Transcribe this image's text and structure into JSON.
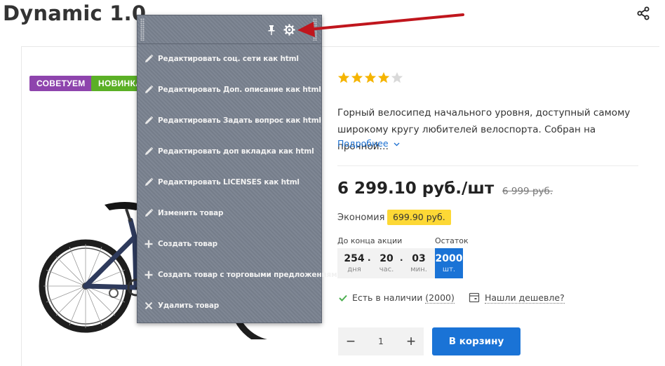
{
  "page": {
    "title": "Dynamic 1.0"
  },
  "badges": {
    "advise": "СОВЕТУЕМ",
    "new": "НОВИНКА"
  },
  "rating": {
    "stars_filled": 4,
    "stars_total": 5
  },
  "product": {
    "description_line1": "Горный велосипед начального уровня, доступный самому",
    "description_line2": "широкому кругу любителей велоспорта. Собран на прочной…",
    "more_link": "Подробнее",
    "price": "6 299.10 руб./шт",
    "old_price": "6 999 руб.",
    "economy_label": "Экономия",
    "economy_value": "699.90 руб."
  },
  "timer": {
    "label": "До конца акции",
    "days": "254",
    "days_unit": "дня",
    "hours": "20",
    "hours_unit": "час.",
    "minutes": "03",
    "minutes_unit": "мин."
  },
  "stock": {
    "label": "Остаток",
    "value": "2000",
    "unit": "шт."
  },
  "availability": {
    "text": "Есть в наличии",
    "count": "(2000)",
    "cheaper": "Нашли дешевле?"
  },
  "cart": {
    "quantity": "1",
    "minus": "−",
    "plus": "+",
    "button": "В корзину"
  },
  "admin_menu": {
    "items": [
      {
        "label": "Редактировать соц. сети как html",
        "icon": "pencil-icon"
      },
      {
        "label": "Редактировать Доп. описание как html",
        "icon": "pencil-icon"
      },
      {
        "label": "Редактировать Задать вопрос как html",
        "icon": "pencil-icon"
      },
      {
        "label": "Редактировать доп вкладка как html",
        "icon": "pencil-icon"
      },
      {
        "label": "Редактировать LICENSES как html",
        "icon": "pencil-icon"
      },
      {
        "label": "Изменить товар",
        "icon": "pencil-icon"
      },
      {
        "label": "Создать товар",
        "icon": "plus-icon"
      },
      {
        "label": "Создать товар с торговыми предложениями",
        "icon": "plus-icon"
      },
      {
        "label": "Удалить товар",
        "icon": "x-icon"
      }
    ]
  },
  "colors": {
    "brand_blue": "#1a73d6",
    "badge_purple": "#8e44ad",
    "badge_green": "#5bb026",
    "economy_yellow": "#fdd835",
    "star_gold": "#f5b400",
    "arrow_red": "#c0161d",
    "popup_gray": "#7a8290"
  }
}
